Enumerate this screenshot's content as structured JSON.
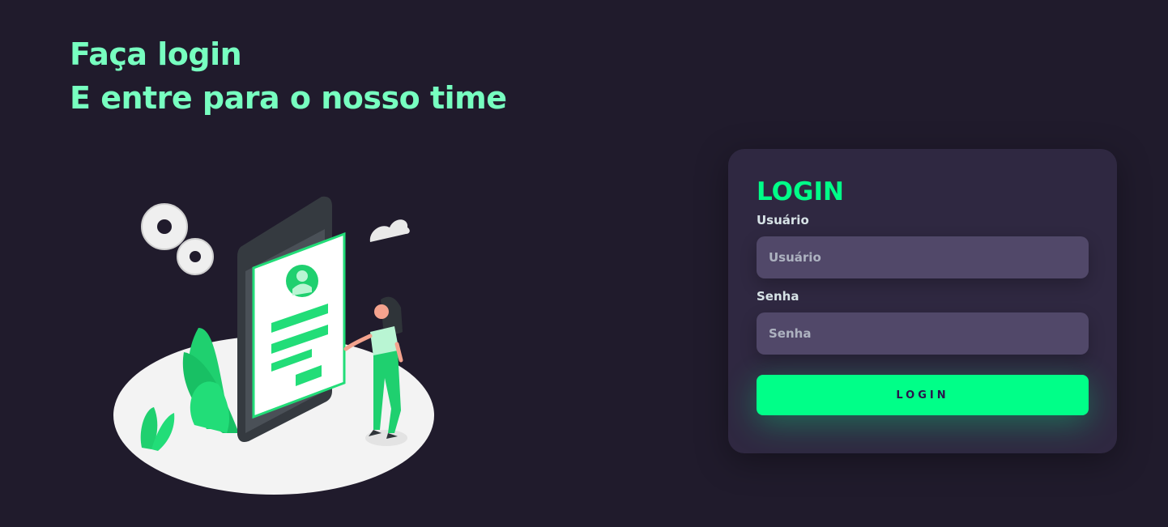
{
  "headline": {
    "line1": "Faça login",
    "line2": "E entre para o nosso time"
  },
  "login_card": {
    "title": "LOGIN",
    "username_label": "Usuário",
    "username_placeholder": "Usuário",
    "password_label": "Senha",
    "password_placeholder": "Senha",
    "submit_label": "LOGIN"
  },
  "colors": {
    "background": "#201b2c",
    "card": "#2f2841",
    "input": "#514869",
    "accent": "#00ff88",
    "headline": "#77ffc0"
  }
}
